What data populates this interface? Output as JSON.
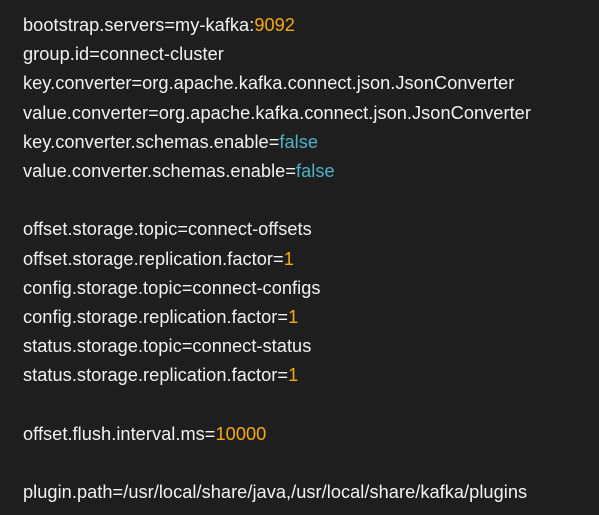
{
  "colors": {
    "background": "#1e1e1e",
    "text": "#f2f2f2",
    "number": "#f6aa11",
    "boolean": "#4fb3c8"
  },
  "lines": [
    {
      "parts": [
        {
          "text": "bootstrap.servers=my-kafka:",
          "kind": "text"
        },
        {
          "text": "9092",
          "kind": "num"
        }
      ]
    },
    {
      "parts": [
        {
          "text": "group.id=connect-cluster",
          "kind": "text"
        }
      ]
    },
    {
      "parts": [
        {
          "text": "key.converter=org.apache.kafka.connect.json.JsonConverter",
          "kind": "text"
        }
      ]
    },
    {
      "parts": [
        {
          "text": "value.converter=org.apache.kafka.connect.json.JsonConverter",
          "kind": "text"
        }
      ]
    },
    {
      "parts": [
        {
          "text": "key.converter.schemas.enable=",
          "kind": "text"
        },
        {
          "text": "false",
          "kind": "bool"
        }
      ]
    },
    {
      "parts": [
        {
          "text": "value.converter.schemas.enable=",
          "kind": "text"
        },
        {
          "text": "false",
          "kind": "bool"
        }
      ]
    },
    {
      "parts": []
    },
    {
      "parts": [
        {
          "text": "offset.storage.topic=connect-offsets",
          "kind": "text"
        }
      ]
    },
    {
      "parts": [
        {
          "text": "offset.storage.replication.factor=",
          "kind": "text"
        },
        {
          "text": "1",
          "kind": "num"
        }
      ]
    },
    {
      "parts": [
        {
          "text": "config.storage.topic=connect-configs",
          "kind": "text"
        }
      ]
    },
    {
      "parts": [
        {
          "text": "config.storage.replication.factor=",
          "kind": "text"
        },
        {
          "text": "1",
          "kind": "num"
        }
      ]
    },
    {
      "parts": [
        {
          "text": "status.storage.topic=connect-status",
          "kind": "text"
        }
      ]
    },
    {
      "parts": [
        {
          "text": "status.storage.replication.factor=",
          "kind": "text"
        },
        {
          "text": "1",
          "kind": "num"
        }
      ]
    },
    {
      "parts": []
    },
    {
      "parts": [
        {
          "text": "offset.flush.interval.ms=",
          "kind": "text"
        },
        {
          "text": "10000",
          "kind": "num"
        }
      ]
    },
    {
      "parts": []
    },
    {
      "parts": [
        {
          "text": "plugin.path=/usr/local/share/java,/usr/local/share/kafka/plugins",
          "kind": "text"
        }
      ]
    }
  ]
}
